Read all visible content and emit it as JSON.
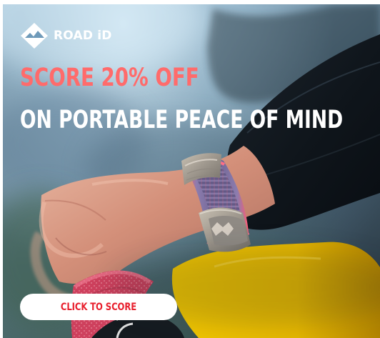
{
  "ad": {
    "brand": {
      "logo_text": "ROAD iD",
      "icon": "mountain-diamond-icon"
    },
    "headline_primary": "SCORE 20% OFF",
    "headline_secondary": "ON PORTABLE PEACE OF MIND",
    "cta_label": "CLICK TO SCORE"
  },
  "colors": {
    "accent_coral": "#ff6b6b",
    "cta_text": "#e81f2d",
    "white": "#ffffff"
  }
}
